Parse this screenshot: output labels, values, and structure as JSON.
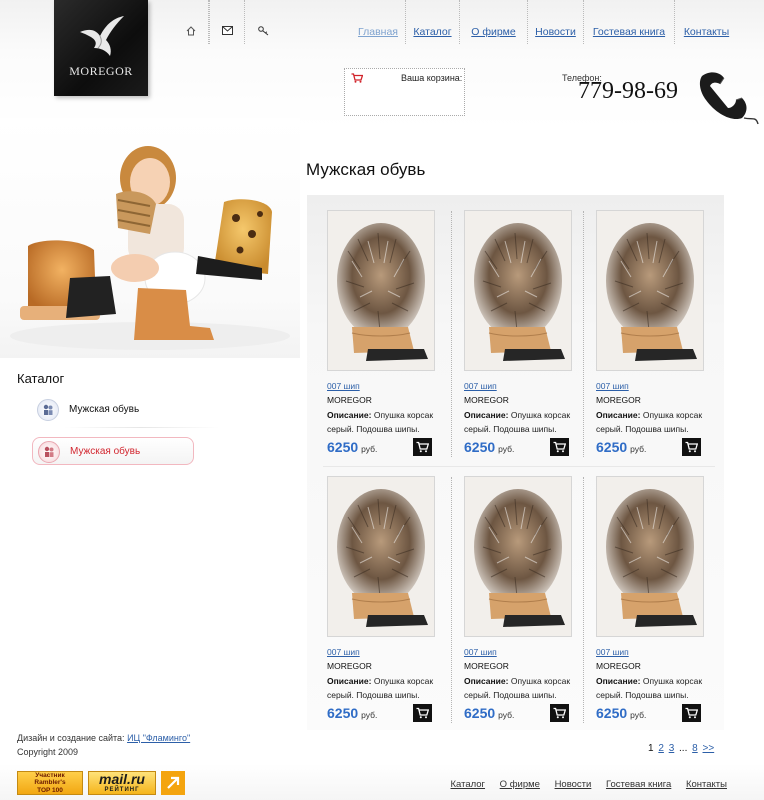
{
  "brand": {
    "logo_text": "MOREGOR"
  },
  "header_icons": [
    {
      "icon": "home-icon"
    },
    {
      "icon": "mail-icon"
    },
    {
      "icon": "key-icon"
    }
  ],
  "nav": {
    "items": [
      {
        "label": "Главная",
        "current": true
      },
      {
        "label": "Каталог"
      },
      {
        "label": "О фирме"
      },
      {
        "label": "Новости"
      },
      {
        "label": "Гостевая книга"
      },
      {
        "label": "Контакты"
      }
    ]
  },
  "cart": {
    "label": "Ваша корзина:",
    "icon": "cart-icon"
  },
  "phone": {
    "label": "Телефон:",
    "number": "779-98-69",
    "icon": "telephone-icon"
  },
  "sidebar": {
    "catalog_title": "Каталог",
    "items": [
      {
        "label": "Мужская обувь",
        "active": false
      },
      {
        "label": "Мужская обувь",
        "active": true
      }
    ]
  },
  "page": {
    "title": "Мужская обувь"
  },
  "products": [
    {
      "name": "007 шип",
      "brand": "MOREGOR",
      "desc_label": "Описание:",
      "desc_text": "Опушка корсак серый. Подошва шипы.",
      "price": "6250",
      "currency": "руб."
    },
    {
      "name": "007 шип",
      "brand": "MOREGOR",
      "desc_label": "Описание:",
      "desc_text": "Опушка корсак серый. Подошва шипы.",
      "price": "6250",
      "currency": "руб."
    },
    {
      "name": "007 шип",
      "brand": "MOREGOR",
      "desc_label": "Описание:",
      "desc_text": "Опушка корсак серый. Подошва шипы.",
      "price": "6250",
      "currency": "руб."
    },
    {
      "name": "007 шип",
      "brand": "MOREGOR",
      "desc_label": "Описание:",
      "desc_text": "Опушка корсак серый. Подошва шипы.",
      "price": "6250",
      "currency": "руб."
    },
    {
      "name": "007 шип",
      "brand": "MOREGOR",
      "desc_label": "Описание:",
      "desc_text": "Опушка корсак серый. Подошва шипы.",
      "price": "6250",
      "currency": "руб."
    },
    {
      "name": "007 шип",
      "brand": "MOREGOR",
      "desc_label": "Описание:",
      "desc_text": "Опушка корсак серый. Подошва шипы.",
      "price": "6250",
      "currency": "руб."
    }
  ],
  "pagination": {
    "current": "1",
    "p2": "2",
    "p3": "3",
    "ellipsis": "...",
    "last": "8",
    "next": ">>"
  },
  "footer": {
    "credit_label": "Дизайн и создание сайта:",
    "credit_link": "ИЦ \"Фламинго\"",
    "copyright": "Copyright 2009",
    "rambler_lines": [
      "Участник",
      "Rambler's",
      "TOP 100"
    ],
    "mail_logo": "mail.ru",
    "mail_sub": "РЕЙТИНГ",
    "links": [
      "Каталог",
      "О фирме",
      "Новости",
      "Гостевая книга",
      "Контакты"
    ]
  },
  "colors": {
    "link": "#2c5fa8",
    "price": "#2f6cc6",
    "active_category": "#d2262f",
    "logo_bg": "#111111"
  }
}
